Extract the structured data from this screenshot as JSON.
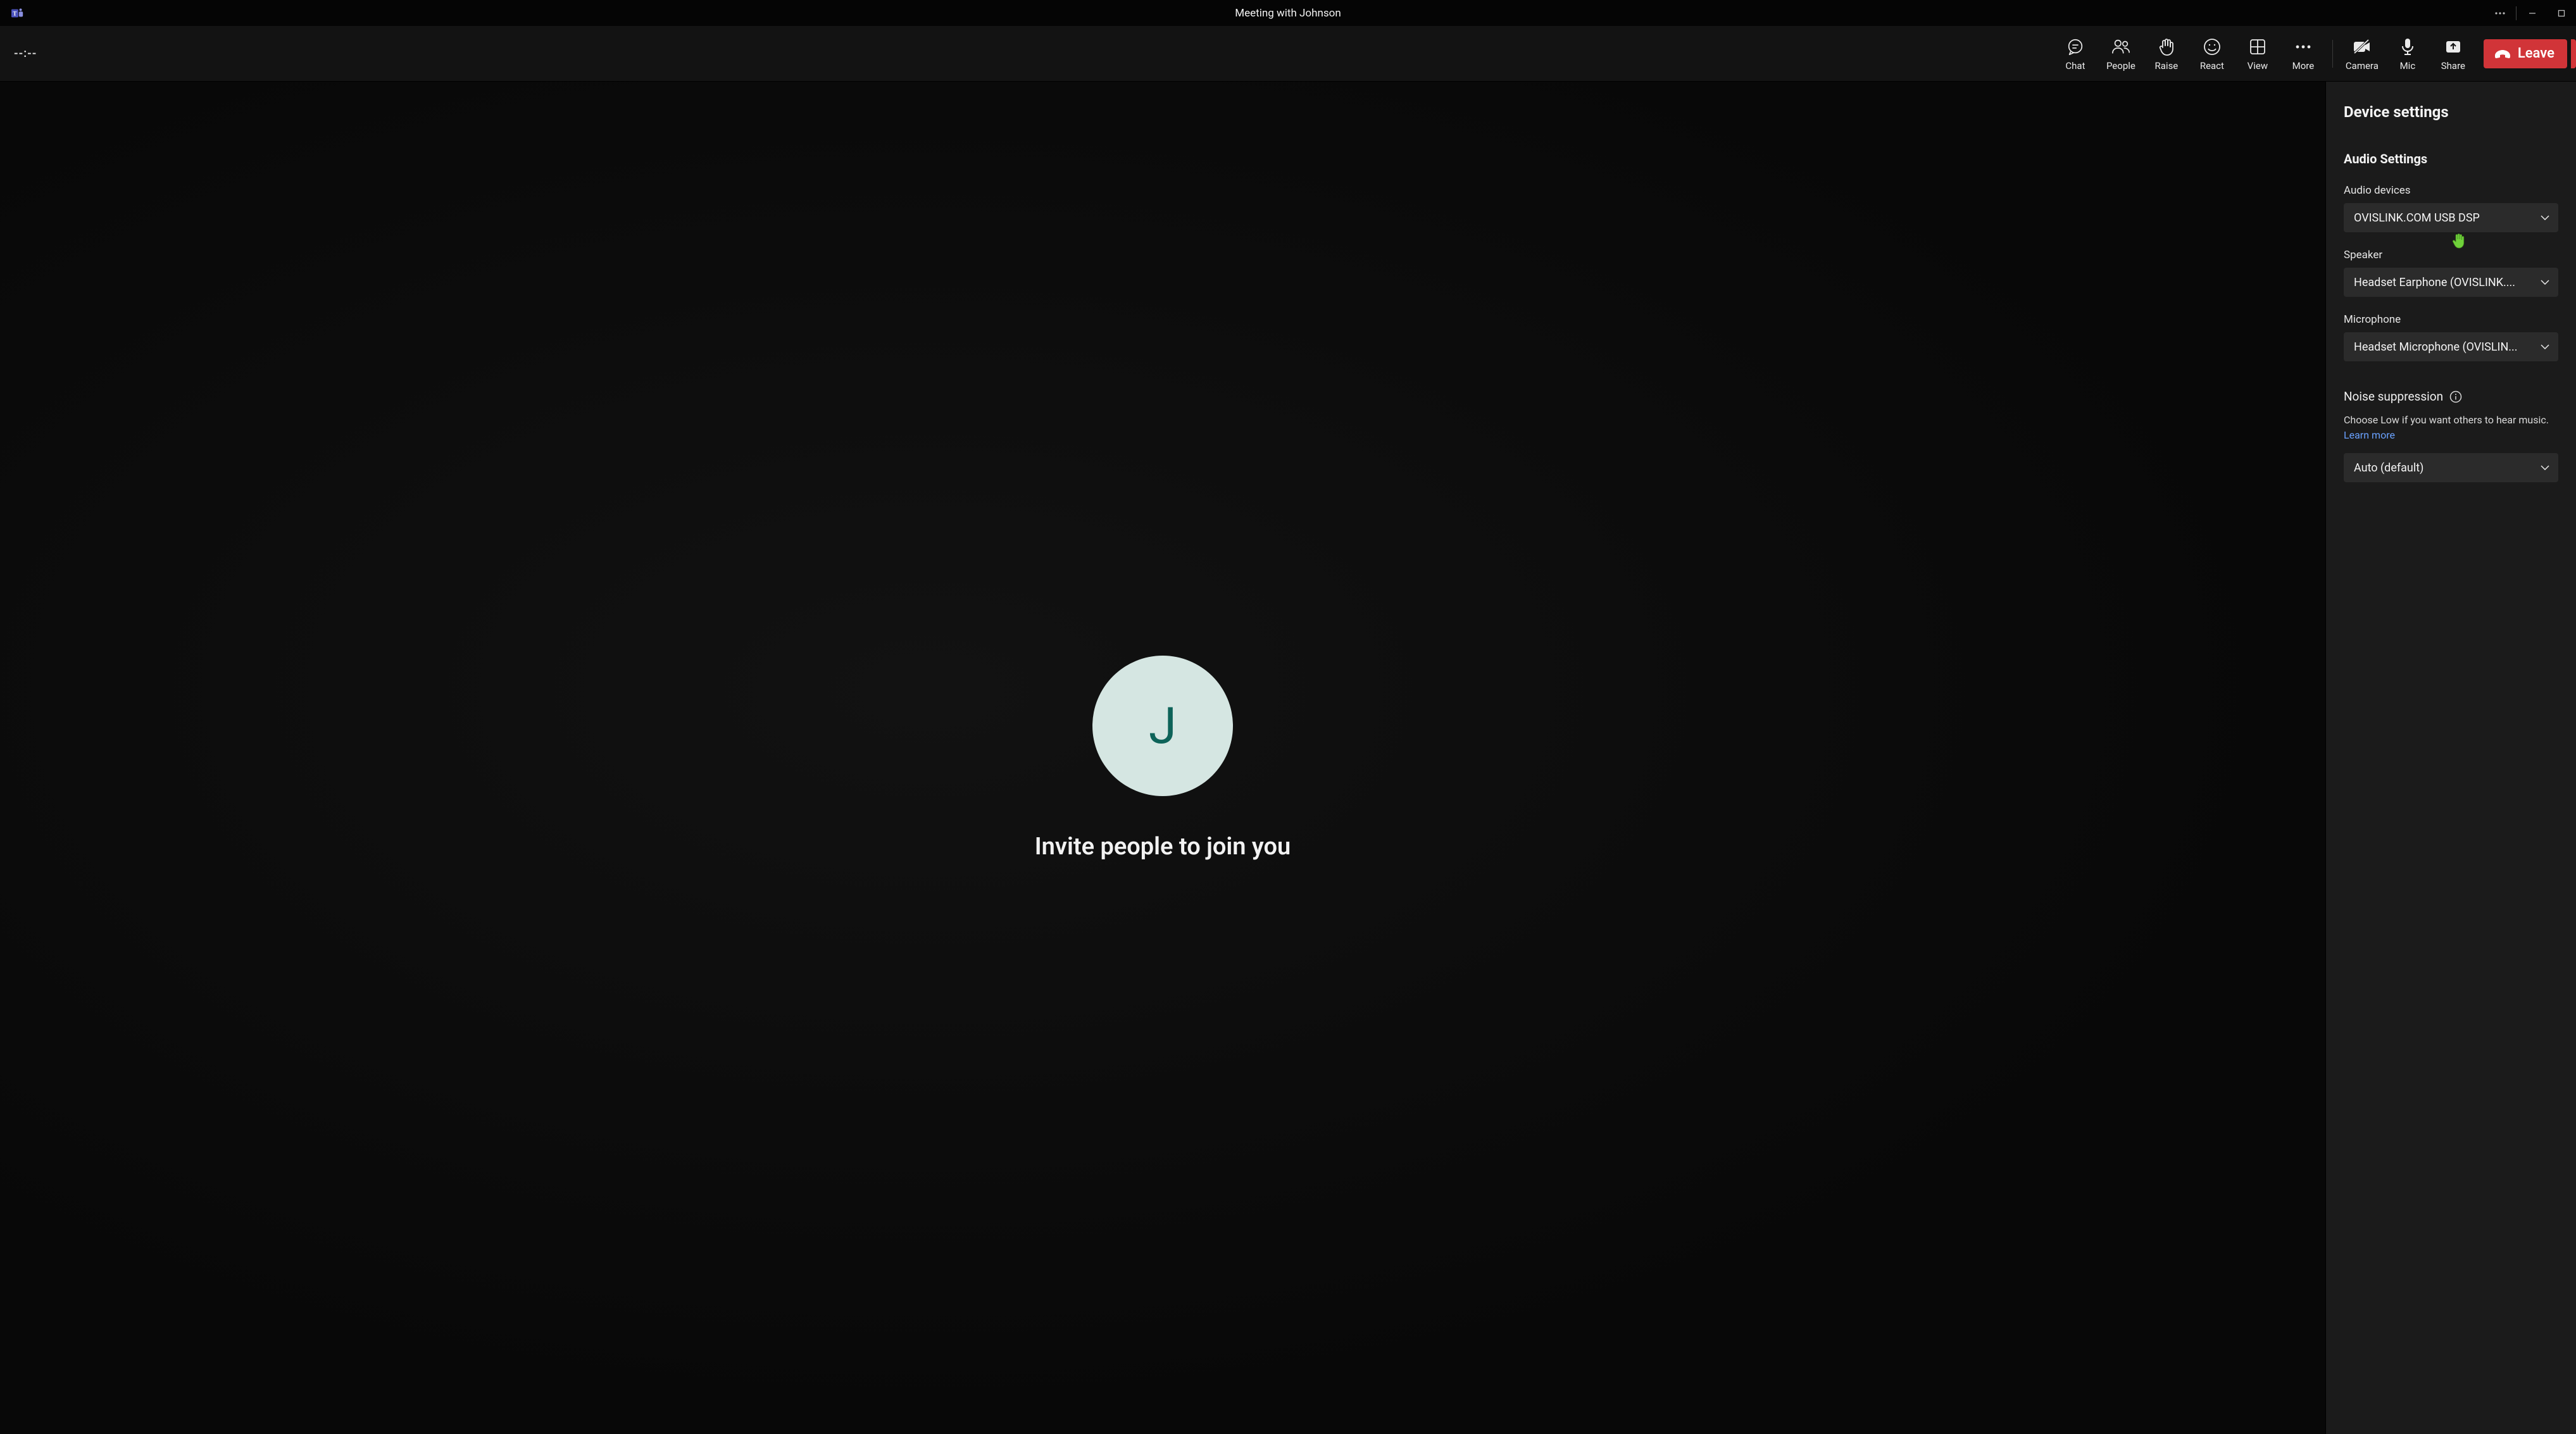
{
  "titlebar": {
    "title": "Meeting with Johnson"
  },
  "toolbar": {
    "timer": "--:--",
    "chat": "Chat",
    "people": "People",
    "raise": "Raise",
    "react": "React",
    "view": "View",
    "more": "More",
    "camera": "Camera",
    "mic": "Mic",
    "share": "Share",
    "leave": "Leave"
  },
  "stage": {
    "avatar_initial": "J",
    "invite": "Invite people to join you"
  },
  "panel": {
    "title": "Device settings",
    "audio_section": "Audio Settings",
    "audio_devices_label": "Audio devices",
    "audio_devices_value": "OVISLINK.COM USB DSP",
    "speaker_label": "Speaker",
    "speaker_value": "Headset Earphone (OVISLINK....",
    "microphone_label": "Microphone",
    "microphone_value": "Headset Microphone (OVISLIN...",
    "noise_label": "Noise suppression",
    "noise_desc_prefix": "Choose Low if you want others to hear music. ",
    "noise_learn": "Learn more",
    "noise_value": "Auto (default)"
  },
  "colors": {
    "leave": "#d13438",
    "avatar_bg": "#d5e6e2",
    "avatar_fg": "#0d6359",
    "link": "#6aa2ff"
  }
}
